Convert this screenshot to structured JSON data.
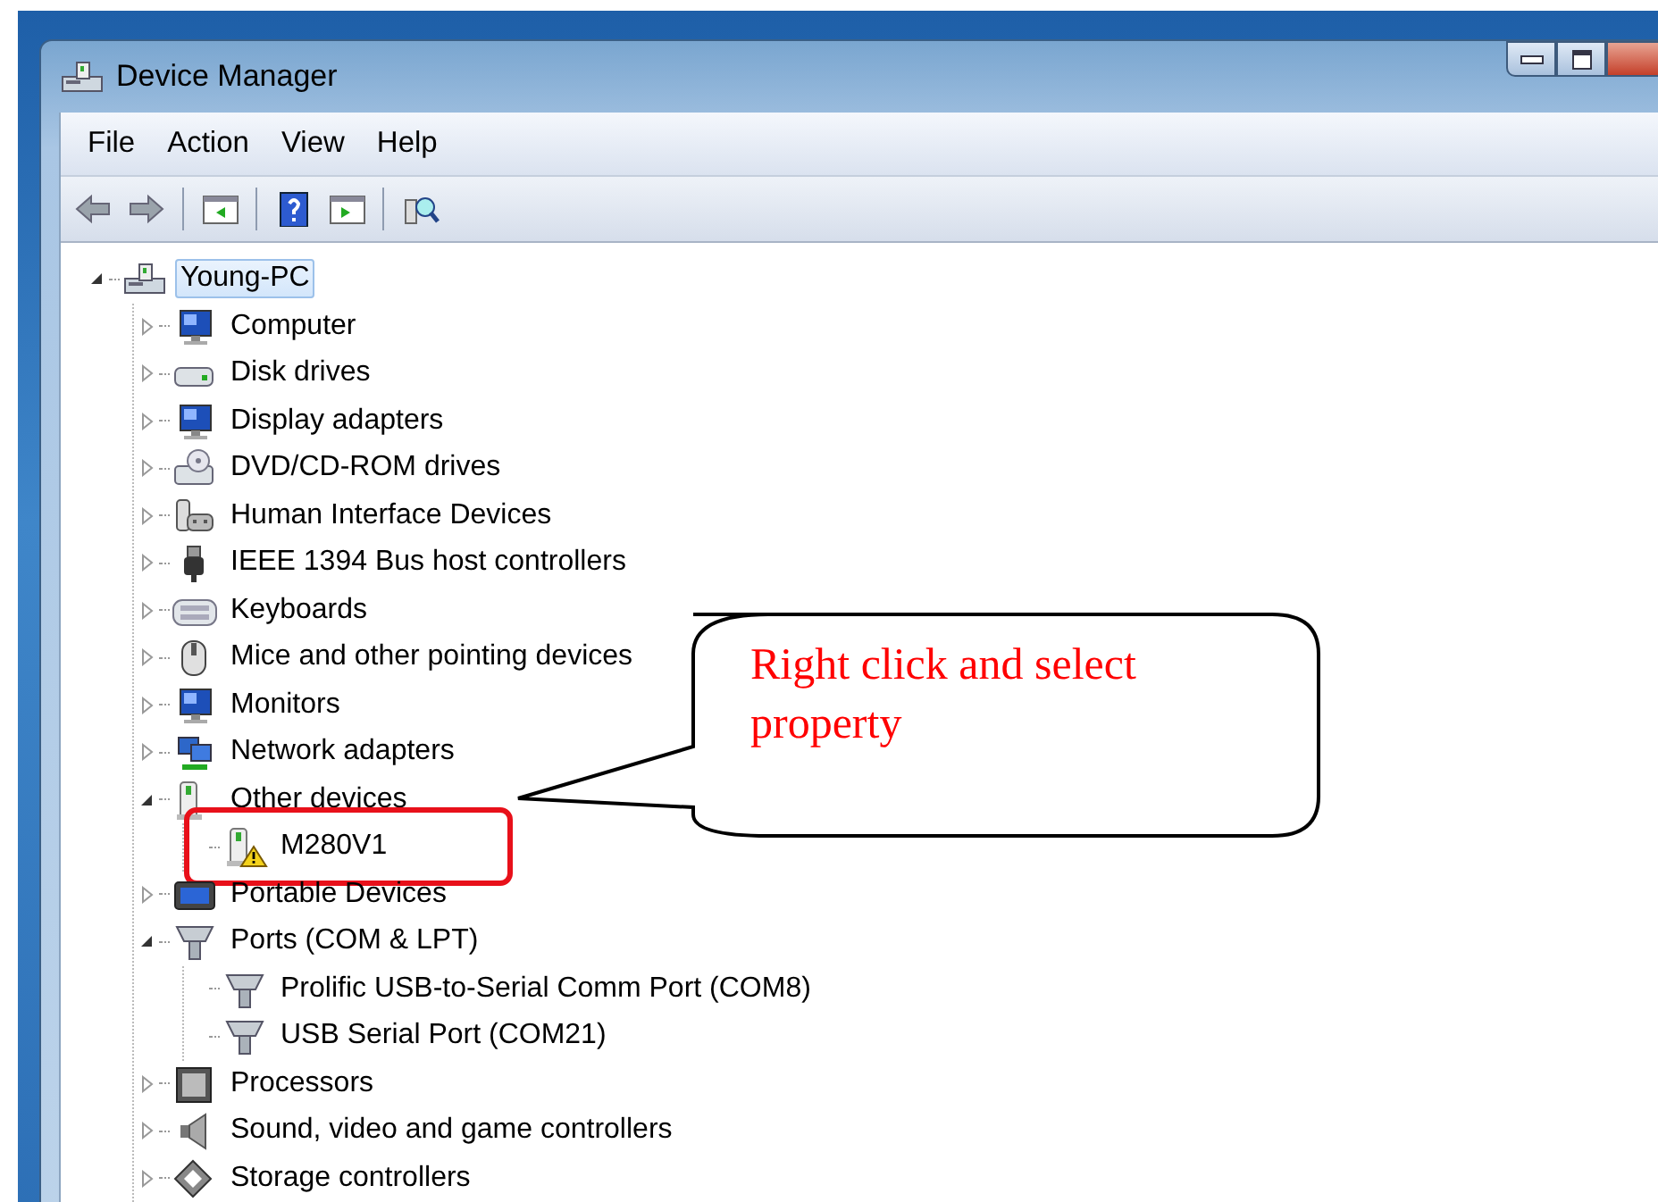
{
  "window": {
    "title": "Device Manager"
  },
  "menu": [
    "File",
    "Action",
    "View",
    "Help"
  ],
  "tree": {
    "label": "Young-PC",
    "selected": true,
    "expanded": true,
    "children": [
      {
        "label": "Computer",
        "expanded": false
      },
      {
        "label": "Disk drives",
        "expanded": false
      },
      {
        "label": "Display adapters",
        "expanded": false
      },
      {
        "label": "DVD/CD-ROM drives",
        "expanded": false
      },
      {
        "label": "Human Interface Devices",
        "expanded": false
      },
      {
        "label": "IEEE 1394 Bus host controllers",
        "expanded": false
      },
      {
        "label": "Keyboards",
        "expanded": false
      },
      {
        "label": "Mice and other pointing devices",
        "expanded": false
      },
      {
        "label": "Monitors",
        "expanded": false
      },
      {
        "label": "Network adapters",
        "expanded": false
      },
      {
        "label": "Other devices",
        "expanded": true,
        "children": [
          {
            "label": "M280V1",
            "warning": true,
            "highlighted": true
          }
        ]
      },
      {
        "label": "Portable Devices",
        "expanded": false
      },
      {
        "label": "Ports (COM & LPT)",
        "expanded": true,
        "children": [
          {
            "label": "Prolific USB-to-Serial Comm Port (COM8)",
            "warning": false,
            "highlighted": false
          },
          {
            "label": "USB Serial Port (COM21)",
            "warning": false,
            "highlighted": false
          }
        ]
      },
      {
        "label": "Processors",
        "expanded": false
      },
      {
        "label": "Sound, video and game controllers",
        "expanded": false
      },
      {
        "label": "Storage controllers",
        "expanded": false
      }
    ]
  },
  "callout": {
    "text": "Right click and select property"
  }
}
